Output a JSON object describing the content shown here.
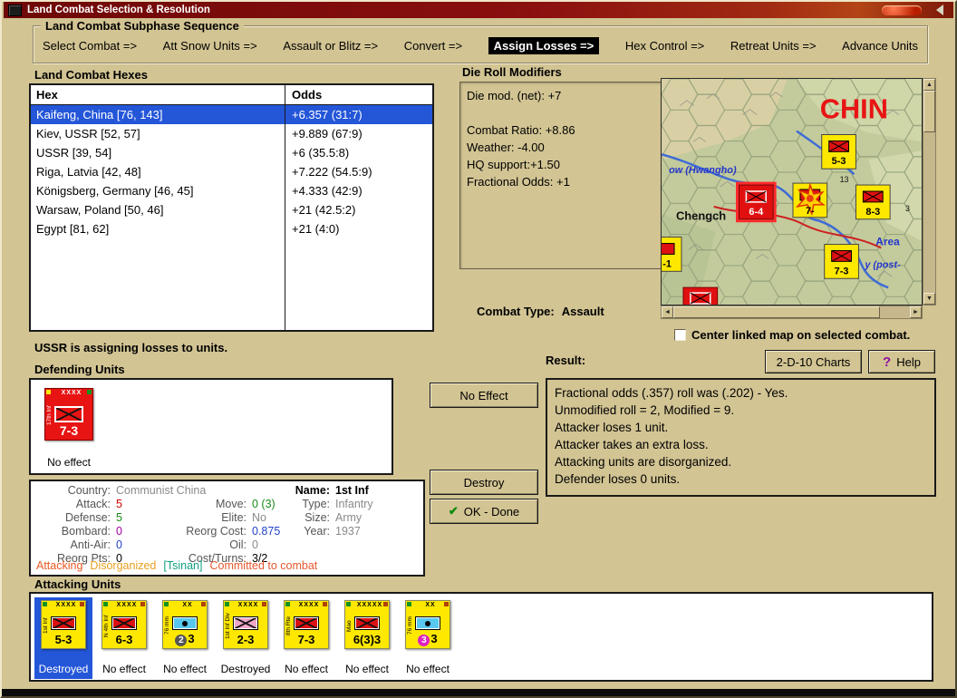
{
  "window": {
    "title": "Land Combat Selection & Resolution"
  },
  "icons": {
    "scroll_up": "▲",
    "scroll_down": "▼",
    "scroll_left": "◄",
    "scroll_right": "►",
    "check": "✔",
    "question": "?"
  },
  "colors": {
    "selection_blue": "#2456d8",
    "counter_yellow": "#ffe800",
    "counter_red": "#e81414",
    "window_tan": "#d2c493",
    "titlebar_red": "#7c0c0c",
    "active_step_bg": "#000000"
  },
  "sequence": {
    "title": "Land Combat Subphase Sequence",
    "steps": [
      {
        "label": "Select Combat =>",
        "active": false
      },
      {
        "label": "Att Snow Units =>",
        "active": false
      },
      {
        "label": "Assault or Blitz =>",
        "active": false
      },
      {
        "label": "Convert =>",
        "active": false
      },
      {
        "label": "Assign Losses =>",
        "active": true
      },
      {
        "label": "Hex Control =>",
        "active": false
      },
      {
        "label": "Retreat Units =>",
        "active": false
      },
      {
        "label": "Advance Units",
        "active": false
      }
    ]
  },
  "combat_hexes": {
    "title": "Land Combat Hexes",
    "columns": [
      "Hex",
      "Odds"
    ],
    "rows": [
      {
        "hex": "Kaifeng, China [76, 143]",
        "odds": "+6.357 (31:7)",
        "selected": true
      },
      {
        "hex": "Kiev, USSR [52, 57]",
        "odds": "+9.889 (67:9)",
        "selected": false
      },
      {
        "hex": "USSR [39, 54]",
        "odds": "+6 (35.5:8)",
        "selected": false
      },
      {
        "hex": "Riga, Latvia [42, 48]",
        "odds": "+7.222 (54.5:9)",
        "selected": false
      },
      {
        "hex": "Königsberg, Germany [46, 45]",
        "odds": "+4.333 (42:9)",
        "selected": false
      },
      {
        "hex": "Warsaw, Poland [50, 46]",
        "odds": "+21 (42.5:2)",
        "selected": false
      },
      {
        "hex": "Egypt [81, 62]",
        "odds": "+21 (4:0)",
        "selected": false
      }
    ]
  },
  "die_roll_modifiers": {
    "title": "Die Roll Modifiers",
    "lines": [
      "Die mod. (net): +7",
      "",
      "Combat Ratio: +8.86",
      "Weather: -4.00",
      "HQ support:+1.50",
      "Fractional Odds: +1"
    ]
  },
  "combat_type": {
    "label": "Combat Type:",
    "value": "Assault"
  },
  "map": {
    "region_label": "CHIN",
    "labels": [
      {
        "text": "ow (Hwangho)",
        "color": "#2435cc"
      },
      {
        "text": "Chengch",
        "color": "#111111"
      },
      {
        "text": "Area",
        "color": "#2435cc"
      },
      {
        "text": "y (post-",
        "color": "#2435cc"
      }
    ],
    "hex_numbers": [
      "13",
      "3"
    ],
    "units": [
      {
        "value": "5-3"
      },
      {
        "value": "6-4"
      },
      {
        "value": "7-"
      },
      {
        "value": "8-3"
      },
      {
        "value": "7-3"
      },
      {
        "value": "-1"
      }
    ]
  },
  "center_checkbox": {
    "label": "Center linked map on selected combat.",
    "checked": false
  },
  "status_text": "USSR is assigning losses to units.",
  "buttons": {
    "charts": "2-D-10 Charts",
    "help": "Help",
    "no_effect": "No Effect",
    "destroy": "Destroy",
    "ok_done": "OK - Done"
  },
  "result": {
    "title": "Result:",
    "lines": [
      "Fractional odds (.357) roll was (.202)  - Yes.",
      "Unmodified roll = 2, Modified = 9.",
      "Attacker loses 1 unit.",
      "Attacker takes an extra loss.",
      "Attacking units are disorganized.",
      "Defender loses 0 units."
    ]
  },
  "defending": {
    "title": "Defending Units",
    "units": [
      {
        "name": "17th Inf",
        "size": "XXXX",
        "symbol": "infantry",
        "symbol_color": "#e81414",
        "symbol_border": "#ffffff",
        "counter_color": "#e81414",
        "text_color": "#ffffff",
        "value": "7-3",
        "status": "No effect",
        "dots": [
          "#ffe800",
          "#15931f"
        ],
        "selected": false
      }
    ]
  },
  "unit_details": {
    "rows": [
      [
        {
          "t": "Country:"
        },
        {
          "t": "Communist China",
          "c": "#8a8a8a"
        },
        {
          "t": ""
        },
        {
          "t": ""
        },
        {
          "t": "Name:",
          "c": "#000000",
          "b": true
        },
        {
          "t": "1st Inf",
          "c": "#000000",
          "b": true
        }
      ],
      [
        {
          "t": "Attack:"
        },
        {
          "t": "5",
          "c": "#cc0000"
        },
        {
          "t": "Move:"
        },
        {
          "t": "0 (3)",
          "c": "#1a8a1a"
        },
        {
          "t": "Type:"
        },
        {
          "t": "Infantry",
          "c": "#8a8a8a"
        }
      ],
      [
        {
          "t": "Defense:"
        },
        {
          "t": "5",
          "c": "#1a8a1a"
        },
        {
          "t": "Elite:"
        },
        {
          "t": "No",
          "c": "#8a8a8a"
        },
        {
          "t": "Size:"
        },
        {
          "t": "Army",
          "c": "#8a8a8a"
        }
      ],
      [
        {
          "t": "Bombard:"
        },
        {
          "t": "0",
          "c": "#a000a0"
        },
        {
          "t": "Reorg Cost:"
        },
        {
          "t": "0.875",
          "c": "#2244cc"
        },
        {
          "t": "Year:"
        },
        {
          "t": "1937",
          "c": "#8a8a8a"
        }
      ],
      [
        {
          "t": "Anti-Air:"
        },
        {
          "t": "0",
          "c": "#2244cc"
        },
        {
          "t": "Oil:"
        },
        {
          "t": "0",
          "c": "#8a8a8a"
        },
        {
          "t": ""
        },
        {
          "t": ""
        }
      ],
      [
        {
          "t": "Reorg Pts:"
        },
        {
          "t": "0",
          "c": "#000000"
        },
        {
          "t": "Cost/Turns:"
        },
        {
          "t": "3/2",
          "c": "#000000"
        },
        {
          "t": ""
        },
        {
          "t": ""
        }
      ]
    ],
    "status_segments": [
      {
        "text": "Attacking",
        "color": "#e85820"
      },
      {
        "text": "Disorganized",
        "color": "#e8a020"
      },
      {
        "text": "[Tsinan]",
        "color": "#10a080"
      },
      {
        "text": "Committed to combat",
        "color": "#e85830"
      }
    ]
  },
  "attacking": {
    "title": "Attacking Units",
    "units": [
      {
        "name": "1st Inf",
        "size": "XXXX",
        "symbol": "infantry",
        "symbol_color": "#dd1111",
        "value": "5-3",
        "status": "Destroyed",
        "selected": true
      },
      {
        "name": "N 4th Inf",
        "size": "XXXX",
        "symbol": "infantry",
        "symbol_color": "#dd1111",
        "value": "6-3",
        "status": "No effect",
        "selected": false
      },
      {
        "name": "76 mm",
        "size": "XX",
        "symbol": "artillery",
        "symbol_color": "#58c8f0",
        "badge": "2",
        "badge_color": "#555555",
        "value": "3",
        "status": "No effect",
        "selected": false
      },
      {
        "name": "1st Inf Div",
        "size": "XXXX",
        "symbol": "infantry",
        "symbol_color": "#f0a8c8",
        "value": "2-3",
        "status": "Destroyed",
        "selected": false
      },
      {
        "name": "8th Rte",
        "size": "XXXX",
        "symbol": "infantry",
        "symbol_color": "#dd1111",
        "value": "7-3",
        "status": "No effect",
        "selected": false
      },
      {
        "name": "Mao",
        "size": "XXXXX",
        "symbol": "infantry",
        "symbol_color": "#dd1111",
        "value": "6(3)3",
        "status": "No effect",
        "selected": false
      },
      {
        "name": "76 mm",
        "size": "XX",
        "symbol": "artillery",
        "symbol_color": "#58c8f0",
        "badge": "3",
        "badge_color": "#e020c0",
        "value": "3",
        "status": "No effect",
        "selected": false
      }
    ]
  }
}
